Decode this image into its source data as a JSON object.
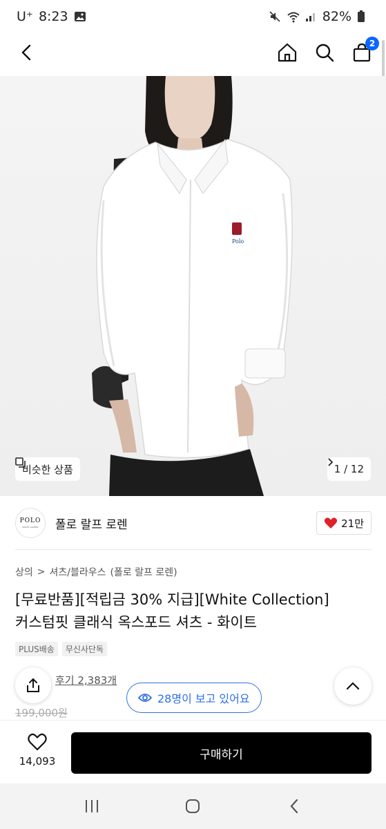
{
  "status_bar": {
    "carrier": "U⁺",
    "time": "8:23",
    "battery": "82%"
  },
  "nav": {
    "cart_count": "2"
  },
  "hero": {
    "similar_label": "비슷한 상품",
    "page_counter": "1 / 12",
    "shirt_logo_text": "Polo"
  },
  "brand": {
    "logo_text": "POLO",
    "logo_sub": "RALPH LAUREN",
    "name": "폴로 랄프 로렌",
    "likes": "21만"
  },
  "breadcrumb": {
    "level1": "상의",
    "separator": ">",
    "level2": "셔츠/블라우스",
    "brand_suffix": "(폴로 랄프 로렌)"
  },
  "product": {
    "title_line1": "[무료반품][적립금 30% 지급][White Collection]",
    "title_line2": "커스텀핏 클래식 옥스포드 셔츠 - 화이트",
    "tags": [
      "PLUS배송",
      "무신사단독"
    ],
    "review_text": "후기 2,383개",
    "original_price": "199,000원"
  },
  "viewers": {
    "text": "28명이 보고 있어요"
  },
  "bottom": {
    "wish_count": "14,093",
    "buy_label": "구매하기"
  },
  "colors": {
    "accent_blue": "#2f6fe4",
    "badge_blue": "#0a66ff",
    "heart_red": "#e0202a",
    "buy_black": "#000000"
  }
}
